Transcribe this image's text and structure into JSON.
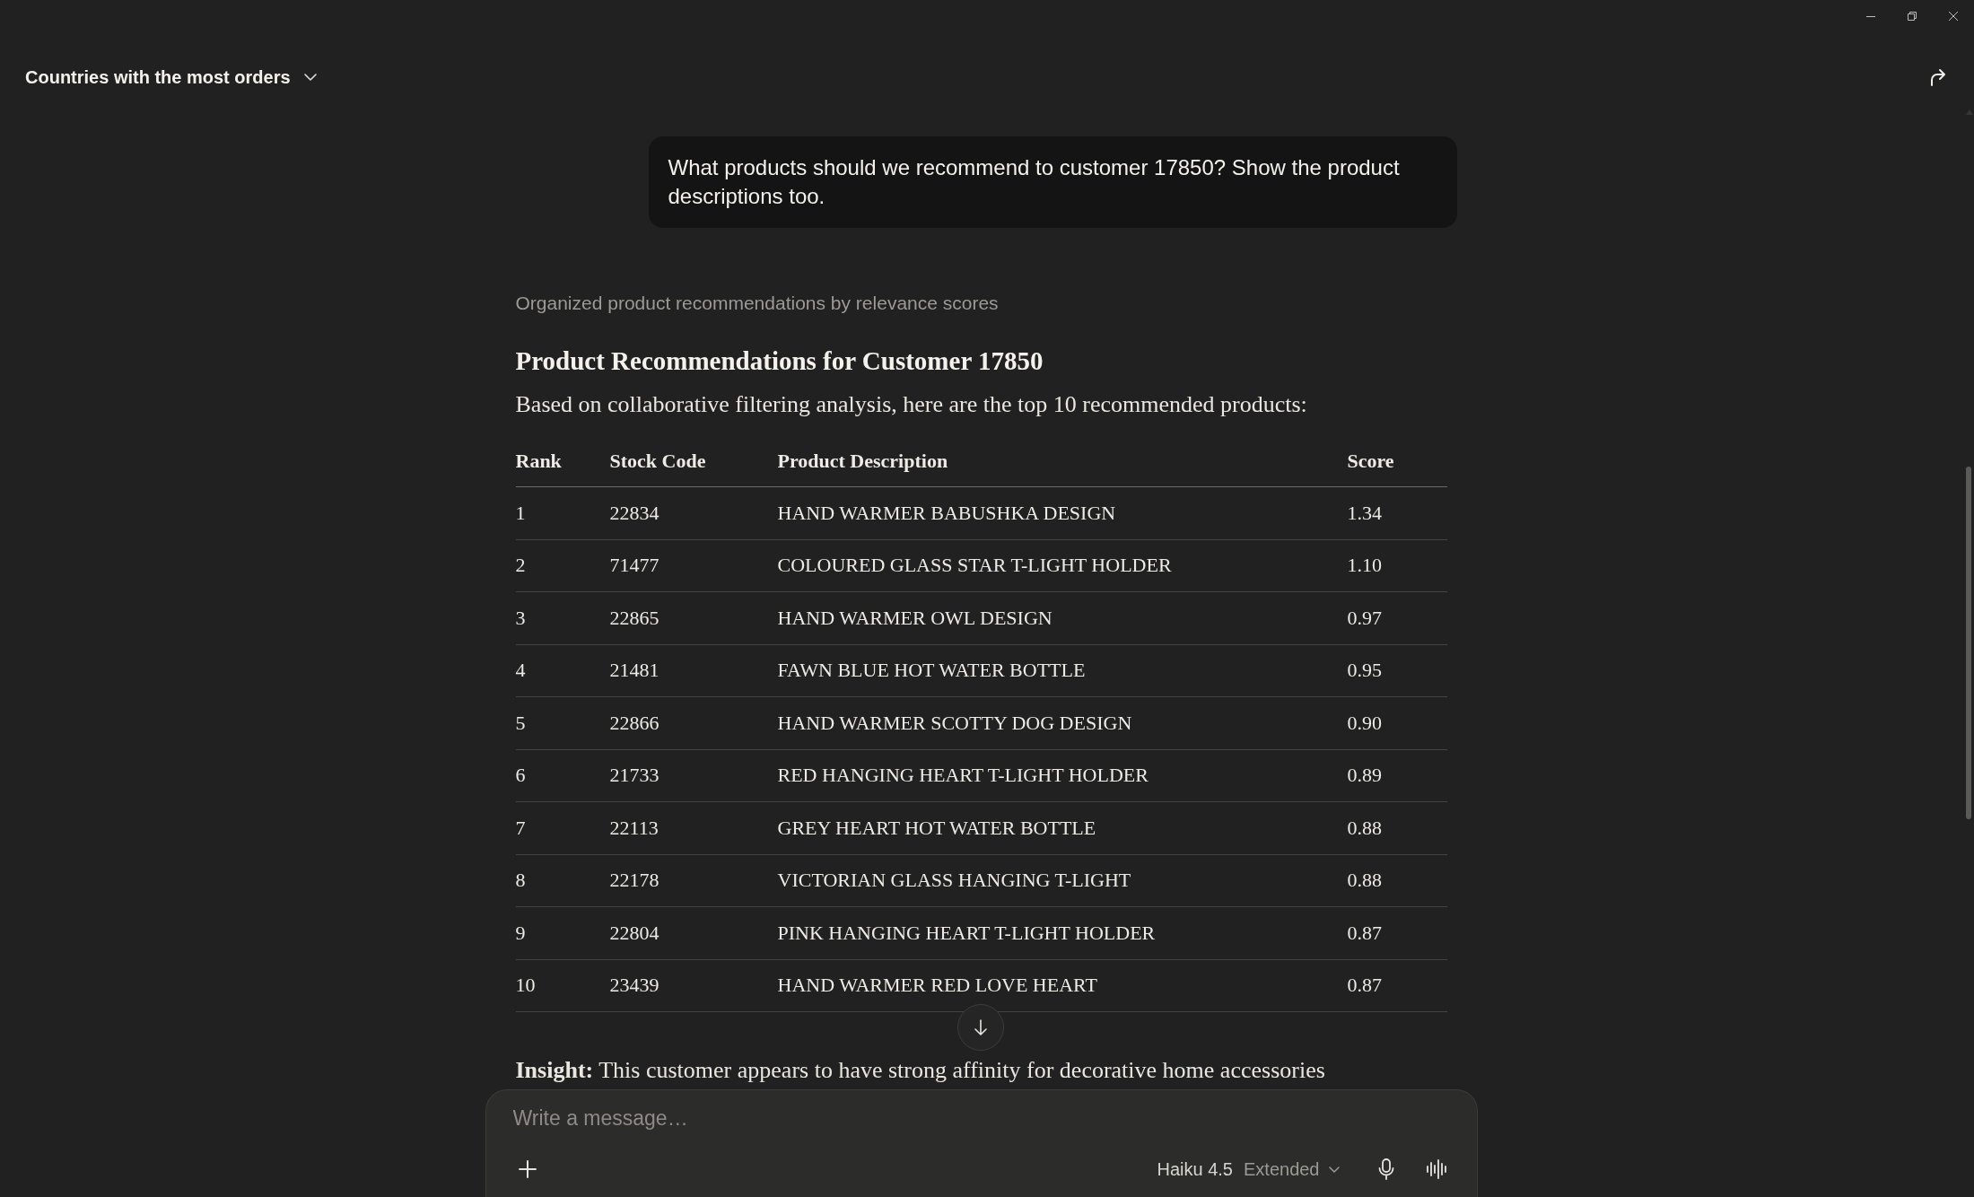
{
  "header": {
    "title": "Countries with the most orders"
  },
  "user_message": {
    "text": "What products should we recommend to customer 17850? Show the product descriptions too."
  },
  "response": {
    "status": "Organized product recommendations by relevance scores",
    "heading": "Product Recommendations for Customer 17850",
    "intro": "Based on collaborative filtering analysis, here are the top 10 recommended products:",
    "table": {
      "columns": [
        "Rank",
        "Stock Code",
        "Product Description",
        "Score"
      ],
      "rows": [
        [
          "1",
          "22834",
          "HAND WARMER BABUSHKA DESIGN",
          "1.34"
        ],
        [
          "2",
          "71477",
          "COLOURED GLASS STAR T-LIGHT HOLDER",
          "1.10"
        ],
        [
          "3",
          "22865",
          "HAND WARMER OWL DESIGN",
          "0.97"
        ],
        [
          "4",
          "21481",
          "FAWN BLUE HOT WATER BOTTLE",
          "0.95"
        ],
        [
          "5",
          "22866",
          "HAND WARMER SCOTTY DOG DESIGN",
          "0.90"
        ],
        [
          "6",
          "21733",
          "RED HANGING HEART T-LIGHT HOLDER",
          "0.89"
        ],
        [
          "7",
          "22113",
          "GREY HEART HOT WATER BOTTLE",
          "0.88"
        ],
        [
          "8",
          "22178",
          "VICTORIAN GLASS HANGING T-LIGHT",
          "0.88"
        ],
        [
          "9",
          "22804",
          "PINK HANGING HEART T-LIGHT HOLDER",
          "0.87"
        ],
        [
          "10",
          "23439",
          "HAND WARMER RED LOVE HEART",
          "0.87"
        ]
      ]
    },
    "insight": "**Insight:** This customer appears to have strong affinity for decorative home accessories"
  },
  "composer": {
    "placeholder": "Write a message…",
    "model": "Haiku 4.5",
    "mode": "Extended"
  }
}
